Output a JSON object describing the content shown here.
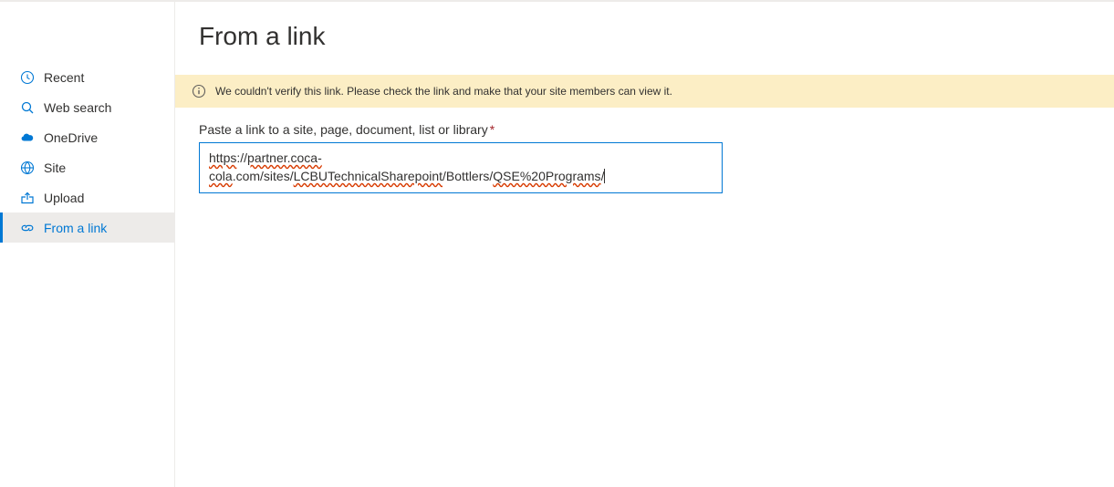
{
  "sidebar": {
    "items": [
      {
        "label": "Recent"
      },
      {
        "label": "Web search"
      },
      {
        "label": "OneDrive"
      },
      {
        "label": "Site"
      },
      {
        "label": "Upload"
      },
      {
        "label": "From a link"
      }
    ]
  },
  "page": {
    "title": "From a link"
  },
  "banner": {
    "message": "We couldn't verify this link. Please check the link and make that your site members can view it."
  },
  "form": {
    "label": "Paste a link to a site, page, document, list or library",
    "required_marker": "*",
    "link_segments": {
      "s0": "https",
      "s1": "://",
      "s2": "partner.coca-cola",
      "s3": ".com/sites/",
      "s4": "LCBUTechnicalSharepoint",
      "s5": "/Bottlers/",
      "s6": "QSE%20Programs",
      "s7": "/"
    }
  }
}
